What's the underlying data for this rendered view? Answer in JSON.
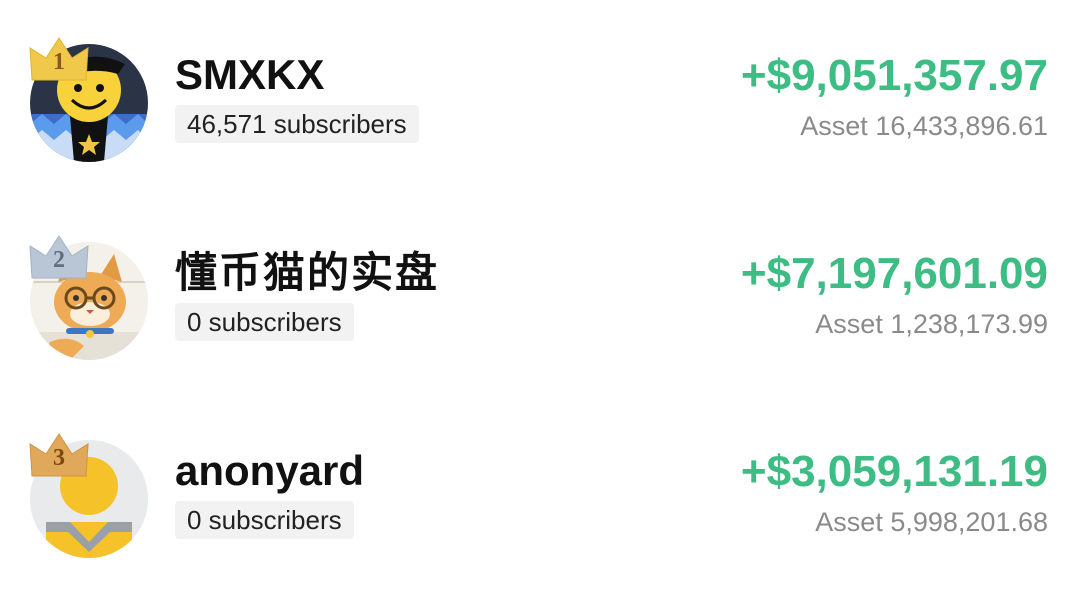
{
  "leaderboard": {
    "entries": [
      {
        "rank": "1",
        "name": "SMXKX",
        "subscribers": "46,571 subscribers",
        "profit": "+$9,051,357.97",
        "asset_label": "Asset",
        "asset_value": "16,433,896.61"
      },
      {
        "rank": "2",
        "name": "懂币猫的实盘",
        "subscribers": "0 subscribers",
        "profit": "+$7,197,601.09",
        "asset_label": "Asset",
        "asset_value": "1,238,173.99"
      },
      {
        "rank": "3",
        "name": "anonyard",
        "subscribers": "0 subscribers",
        "profit": "+$3,059,131.19",
        "asset_label": "Asset",
        "asset_value": "5,998,201.68"
      }
    ]
  },
  "colors": {
    "profit": "#3dbc84",
    "asset": "#8a8a8a",
    "badge_bg": "#f2f2f2",
    "crown_gold": "#f0c94a",
    "crown_silver": "#b9c6d6",
    "crown_bronze": "#e0a85a"
  },
  "icons": {
    "rank_1": "gold-crown-icon",
    "rank_2": "silver-crown-icon",
    "rank_3": "bronze-crown-icon"
  }
}
